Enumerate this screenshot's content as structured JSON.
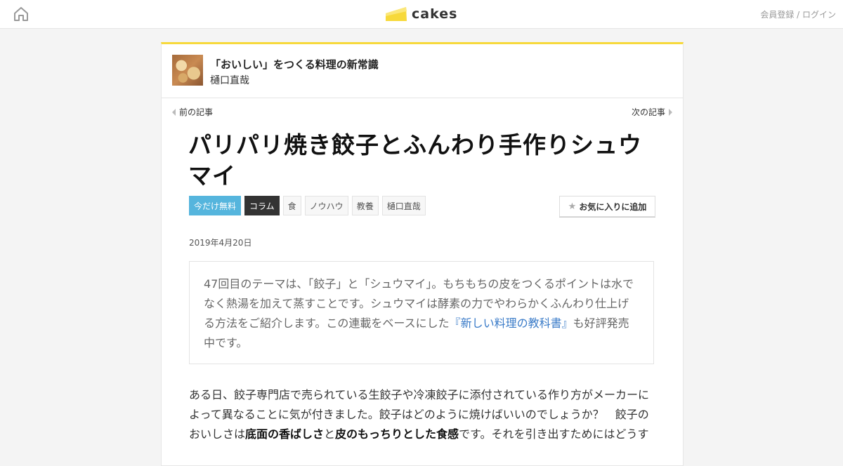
{
  "header": {
    "logo_text": "cakes",
    "auth_links": "会員登録 / ログイン"
  },
  "series": {
    "title": "「おいしい」をつくる料理の新常識",
    "author": "樋口直哉"
  },
  "pager": {
    "prev_label": "前の記事",
    "next_label": "次の記事"
  },
  "article": {
    "title": "パリパリ焼き餃子とふんわり手作りシュウマイ",
    "tags": [
      "今だけ無料",
      "コラム",
      "食",
      "ノウハウ",
      "教養",
      "樋口直哉"
    ],
    "favorite_label": "お気に入りに追加",
    "date": "2019年4月20日",
    "lead_text_1": "47回目のテーマは、「餃子」と「シュウマイ」。もちもちの皮をつくるポイントは水でなく熱湯を加えて蒸すことです。シュウマイは酵素の力でやわらかくふんわり仕上げる方法をご紹介します。この連載をベースにした",
    "lead_link": "『新しい料理の教科書』",
    "lead_text_2": "も好評発売中です。",
    "body_1": "ある日、餃子専門店で売られている生餃子や冷凍餃子に添付されている作り方がメーカーによって異なることに気が付きました。餃子はどのように焼けばいいのでしょうか？　餃子のおいしさは",
    "body_bold_1": "底面の香ばしさ",
    "body_2": "と",
    "body_bold_2": "皮のもっちりとした食感",
    "body_3": "です。それを引き出すためにはどうす"
  },
  "colors": {
    "accent_yellow": "#f7d93b",
    "free_tag": "#55b5dd",
    "link_blue": "#3a7bc8"
  }
}
